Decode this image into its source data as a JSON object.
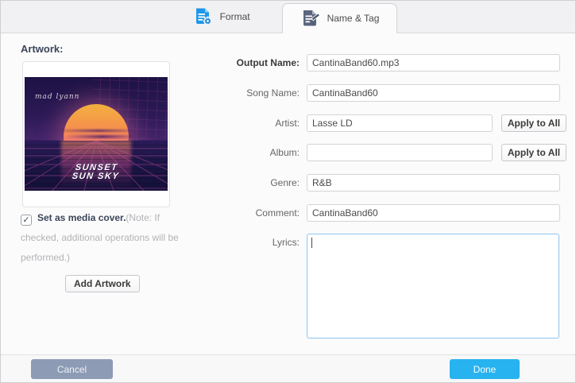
{
  "tabs": [
    {
      "label": "Format",
      "active": false
    },
    {
      "label": "Name & Tag",
      "active": true
    }
  ],
  "artwork": {
    "section_label": "Artwork:",
    "image": {
      "signature": "mad lyann",
      "title_line1": "SUNSET",
      "title_line2": "SUN SKY"
    },
    "checkbox": {
      "checked": true,
      "check_glyph": "✓",
      "label": "Set as media cover.",
      "note": "(Note: If checked, additional operations will be performed.)"
    },
    "add_button": "Add Artwork"
  },
  "form": {
    "fields": [
      {
        "label": "Output Name:",
        "value": "CantinaBand60.mp3"
      },
      {
        "label": "Song Name:",
        "value": "CantinaBand60"
      },
      {
        "label": "Artist:",
        "value": "Lasse LD",
        "action": "Apply to All"
      },
      {
        "label": "Album:",
        "value": "",
        "action": "Apply to All"
      },
      {
        "label": "Genre:",
        "value": "R&B"
      },
      {
        "label": "Comment:",
        "value": "CantinaBand60"
      },
      {
        "label": "Lyrics:",
        "value": ""
      }
    ]
  },
  "footer": {
    "cancel_label": "Cancel",
    "done_label": "Done"
  },
  "colors": {
    "accent_blue": "#27b2f0",
    "tab_icon_blue": "#1e97e8",
    "tab_icon_slate": "#5a647c",
    "cancel_gray_blue": "#8d9bb4",
    "lyrics_focus_border": "#8fc3ee"
  }
}
